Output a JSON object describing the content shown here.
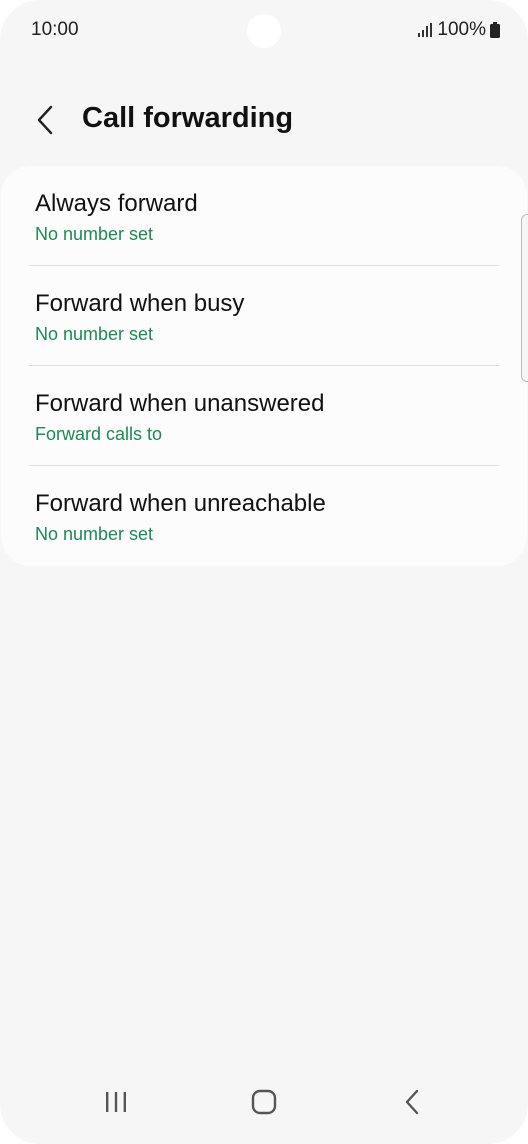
{
  "status": {
    "time": "10:00",
    "battery": "100%"
  },
  "header": {
    "title": "Call forwarding"
  },
  "options": [
    {
      "title": "Always forward",
      "subtitle": "No number set"
    },
    {
      "title": "Forward when busy",
      "subtitle": "No number set"
    },
    {
      "title": "Forward when unanswered",
      "subtitle": "Forward calls to"
    },
    {
      "title": "Forward when unreachable",
      "subtitle": "No number set"
    }
  ],
  "colors": {
    "accent": "#1b8a55",
    "background": "#f6f6f6",
    "card": "#fcfcfc"
  },
  "icons": {
    "back": "chevron-left-icon",
    "signal": "signal-icon",
    "battery": "battery-icon",
    "recents": "recent-apps-icon",
    "home": "home-icon",
    "nav_back": "nav-back-icon"
  }
}
